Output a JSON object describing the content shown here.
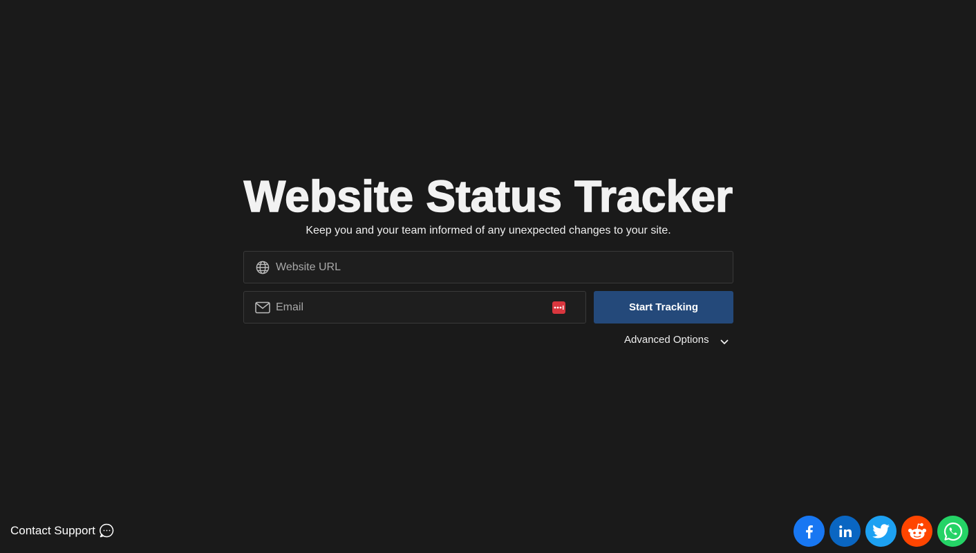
{
  "hero": {
    "title": "Website Status Tracker",
    "subtitle": "Keep you and your team informed of any unexpected changes to your site."
  },
  "form": {
    "url_placeholder": "Website URL",
    "email_placeholder": "Email",
    "submit_label": "Start Tracking",
    "advanced_label": "Advanced Options"
  },
  "footer": {
    "support_label": "Contact Support",
    "socials": [
      {
        "name": "facebook",
        "icon": "facebook-icon",
        "color": "#1877f2"
      },
      {
        "name": "linkedin",
        "icon": "linkedin-icon",
        "color": "#0a66c2"
      },
      {
        "name": "twitter",
        "icon": "twitter-icon",
        "color": "#1da1f2"
      },
      {
        "name": "reddit",
        "icon": "reddit-icon",
        "color": "#ff4500"
      },
      {
        "name": "whatsapp",
        "icon": "whatsapp-icon",
        "color": "#25d366"
      }
    ]
  },
  "colors": {
    "background": "#1a1a1a",
    "accent": "#24497a",
    "field_border": "#3a3a3a",
    "password_badge": "#d9363e"
  }
}
